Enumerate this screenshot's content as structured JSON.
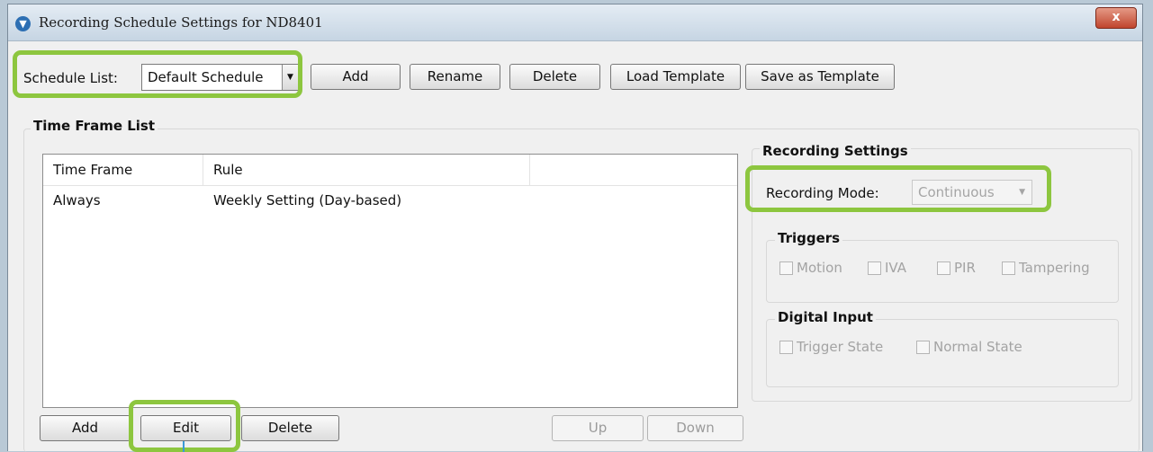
{
  "window": {
    "title": "Recording Schedule Settings for ND8401",
    "close": "x"
  },
  "schedule": {
    "label": "Schedule List:",
    "selected": "Default Schedule",
    "buttons": {
      "add": "Add",
      "rename": "Rename",
      "delete": "Delete",
      "load_template": "Load Template",
      "save_template": "Save as Template"
    }
  },
  "time_frame": {
    "title": "Time Frame List",
    "columns": [
      "Time Frame",
      "Rule"
    ],
    "rows": [
      {
        "time_frame": "Always",
        "rule": "Weekly Setting (Day-based)"
      }
    ],
    "buttons": {
      "add": "Add",
      "edit": "Edit",
      "delete": "Delete",
      "up": "Up",
      "down": "Down"
    }
  },
  "recording": {
    "title": "Recording Settings",
    "mode_label": "Recording Mode:",
    "mode_value": "Continuous",
    "triggers": {
      "title": "Triggers",
      "items": [
        "Motion",
        "IVA",
        "PIR",
        "Tampering"
      ]
    },
    "digital_input": {
      "title": "Digital Input",
      "items": [
        "Trigger State",
        "Normal State"
      ]
    }
  },
  "colors": {
    "highlight": "#8dc63f",
    "window_bg": "#f0f0f0",
    "close_button": "#c0452e"
  }
}
